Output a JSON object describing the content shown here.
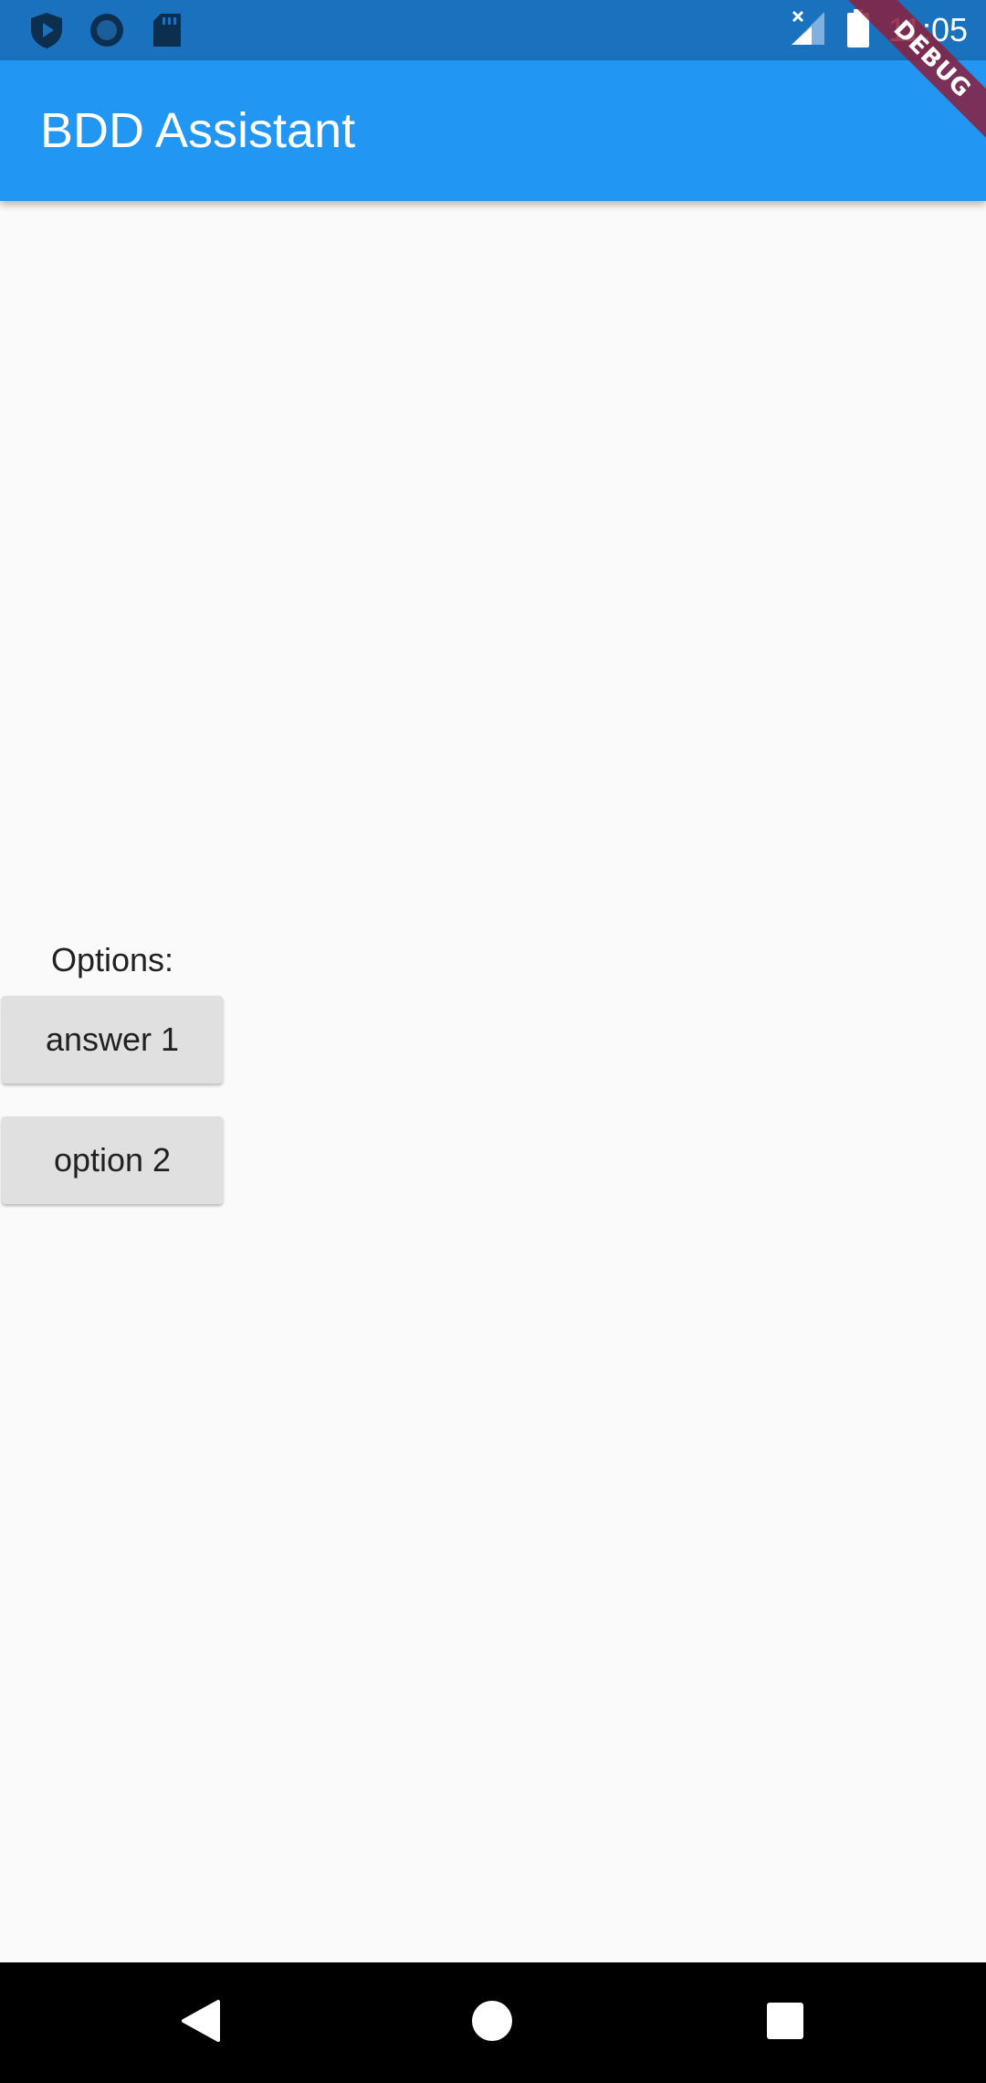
{
  "status_bar": {
    "time": "11:05",
    "left_icons": [
      "play-protect-icon",
      "circle-notification-icon",
      "sd-card-icon"
    ],
    "right_icons": [
      "signal-no-service-icon",
      "battery-icon"
    ]
  },
  "debug_banner": {
    "label": "DEBUG"
  },
  "app_bar": {
    "title": "BDD Assistant"
  },
  "options": {
    "label": "Options:",
    "buttons": [
      {
        "label": "answer 1"
      },
      {
        "label": "option 2"
      }
    ]
  },
  "nav_bar": {
    "buttons": [
      "back-icon",
      "home-icon",
      "recents-icon"
    ]
  },
  "colors": {
    "status_bar": "#1a71bd",
    "app_bar": "#2196f3",
    "background": "#fafafa",
    "button": "#e0e0e0",
    "debug_ribbon": "#8b1f3d"
  }
}
